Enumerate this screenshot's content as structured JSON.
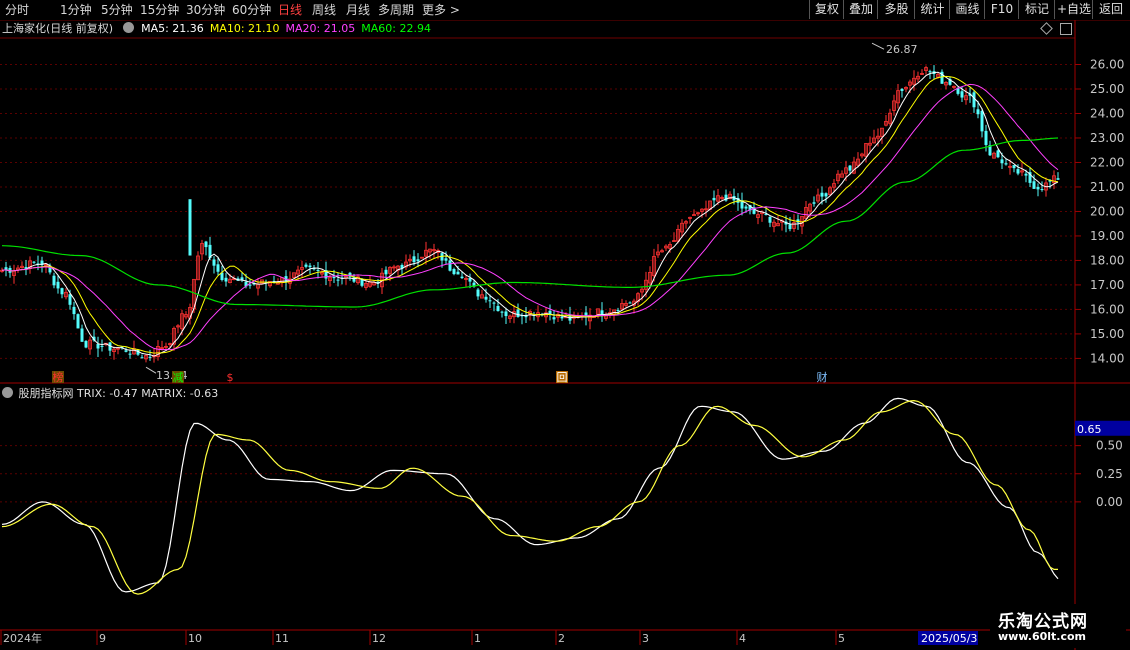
{
  "toolbar": {
    "periods": [
      "分时",
      "1分钟",
      "5分钟",
      "15分钟",
      "30分钟",
      "60分钟",
      "日线",
      "周线",
      "月线",
      "多周期",
      "更多 >"
    ],
    "active_period": "日线",
    "right_buttons": [
      "复权",
      "叠加",
      "多股",
      "统计",
      "画线",
      "F10",
      "标记",
      "+自选",
      "返回"
    ]
  },
  "main_panel": {
    "title": "上海家化(日线 前复权)",
    "ma_labels": [
      {
        "text": "MA5: 21.36",
        "color": "#ffffff"
      },
      {
        "text": "MA10: 21.10",
        "color": "#ffff00"
      },
      {
        "text": "MA20: 21.05",
        "color": "#ff40ff"
      },
      {
        "text": "MA60: 22.94",
        "color": "#00ff00"
      }
    ],
    "high_label": "26.87",
    "low_label": "13.64",
    "price_axis": [
      "26.00",
      "25.00",
      "24.00",
      "23.00",
      "22.00",
      "21.00",
      "20.00",
      "19.00",
      "18.00",
      "17.00",
      "16.00",
      "15.00",
      "14.00"
    ],
    "markers": [
      {
        "text": "榜",
        "color": "#ff3030",
        "bg": "#6b4a00",
        "value_index": 14
      },
      {
        "text": "减",
        "color": "#00ff00",
        "bg": "#6b4a00",
        "value_index": 44
      },
      {
        "text": "$",
        "color": "#ff3030",
        "bg": "none",
        "value_index": 57
      },
      {
        "text": "回",
        "color": "#ffffff",
        "bg": "#b86c00",
        "value_index": 140
      },
      {
        "text": "财",
        "color": "#80c0ff",
        "bg": "none",
        "value_index": 205
      }
    ]
  },
  "indicator_panel": {
    "title": "股朋指标网 TRIX: -0.47 MATRIX: -0.63",
    "current_value_tag": "0.65",
    "axis": [
      "0.50",
      "0.25",
      "0.00"
    ]
  },
  "date_axis": {
    "labels": [
      "2024年",
      "9",
      "10",
      "11",
      "12",
      "1",
      "2",
      "3",
      "4",
      "5"
    ],
    "highlight_date": "2025/05/3"
  },
  "logo": {
    "line1": "乐淘公式网",
    "line2": "www.60lt.com"
  },
  "chart_data": {
    "type": "candlestick",
    "price_range": [
      13.2,
      27.0
    ],
    "indicator_range": [
      -1.05,
      0.95
    ],
    "ma60": [
      [
        0,
        18.6
      ],
      [
        20,
        18.2
      ],
      [
        40,
        17.0
      ],
      [
        60,
        16.2
      ],
      [
        90,
        16.1
      ],
      [
        110,
        16.8
      ],
      [
        130,
        17.1
      ],
      [
        160,
        16.9
      ],
      [
        185,
        17.4
      ],
      [
        200,
        18.3
      ],
      [
        215,
        19.6
      ],
      [
        230,
        21.2
      ],
      [
        245,
        22.5
      ],
      [
        260,
        22.9
      ],
      [
        270,
        23.0
      ]
    ],
    "trix": [
      [
        0,
        -0.2
      ],
      [
        10,
        0.0
      ],
      [
        20,
        -0.2
      ],
      [
        30,
        -0.8
      ],
      [
        38,
        -0.72
      ],
      [
        47,
        0.7
      ],
      [
        55,
        0.55
      ],
      [
        65,
        0.2
      ],
      [
        75,
        0.18
      ],
      [
        85,
        0.1
      ],
      [
        95,
        0.28
      ],
      [
        108,
        0.25
      ],
      [
        120,
        -0.15
      ],
      [
        130,
        -0.38
      ],
      [
        140,
        -0.32
      ],
      [
        150,
        -0.15
      ],
      [
        160,
        0.3
      ],
      [
        170,
        0.85
      ],
      [
        178,
        0.8
      ],
      [
        190,
        0.38
      ],
      [
        200,
        0.45
      ],
      [
        210,
        0.7
      ],
      [
        218,
        0.92
      ],
      [
        225,
        0.85
      ],
      [
        235,
        0.35
      ],
      [
        245,
        -0.05
      ],
      [
        252,
        -0.45
      ],
      [
        258,
        -0.7
      ]
    ],
    "matrix": [
      [
        0,
        -0.22
      ],
      [
        12,
        -0.02
      ],
      [
        22,
        -0.22
      ],
      [
        33,
        -0.82
      ],
      [
        43,
        -0.6
      ],
      [
        52,
        0.6
      ],
      [
        60,
        0.55
      ],
      [
        70,
        0.28
      ],
      [
        80,
        0.18
      ],
      [
        92,
        0.12
      ],
      [
        100,
        0.3
      ],
      [
        112,
        0.05
      ],
      [
        124,
        -0.3
      ],
      [
        135,
        -0.35
      ],
      [
        145,
        -0.22
      ],
      [
        155,
        0.0
      ],
      [
        165,
        0.5
      ],
      [
        174,
        0.85
      ],
      [
        183,
        0.68
      ],
      [
        195,
        0.4
      ],
      [
        205,
        0.55
      ],
      [
        214,
        0.8
      ],
      [
        222,
        0.9
      ],
      [
        232,
        0.6
      ],
      [
        242,
        0.15
      ],
      [
        250,
        -0.25
      ],
      [
        256,
        -0.6
      ]
    ]
  }
}
